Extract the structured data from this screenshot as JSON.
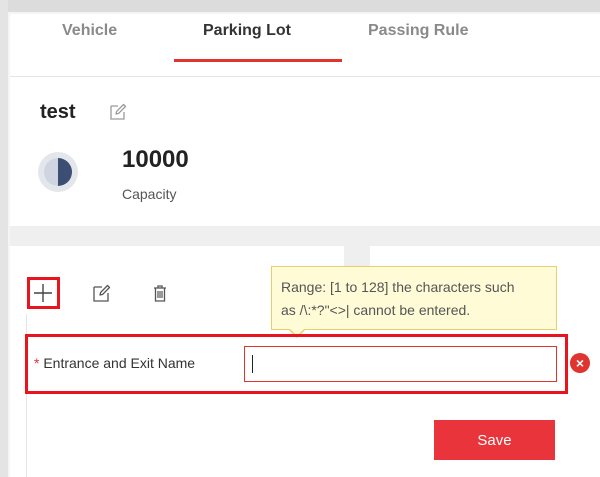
{
  "tabs": [
    {
      "label": "Vehicle"
    },
    {
      "label": "Parking Lot"
    },
    {
      "label": "Passing Rule"
    }
  ],
  "active_tab": "Parking Lot",
  "parking_lot": {
    "name": "test",
    "capacity_value": "10000",
    "capacity_label": "Capacity"
  },
  "tooltip": {
    "line1": "Range: [1 to 128] the characters such",
    "line2": "as /\\:*?\"<>| cannot be entered."
  },
  "form": {
    "required_mark": "*",
    "field_label": "Entrance and Exit Name",
    "field_value": "",
    "save_label": "Save"
  },
  "colors": {
    "accent": "#e0342f",
    "highlight": "#e8141e",
    "tooltip_bg": "#fffbd6"
  },
  "icons": {
    "edit": "edit-icon",
    "add": "plus-icon",
    "delete": "trash-icon",
    "error": "error-icon"
  }
}
